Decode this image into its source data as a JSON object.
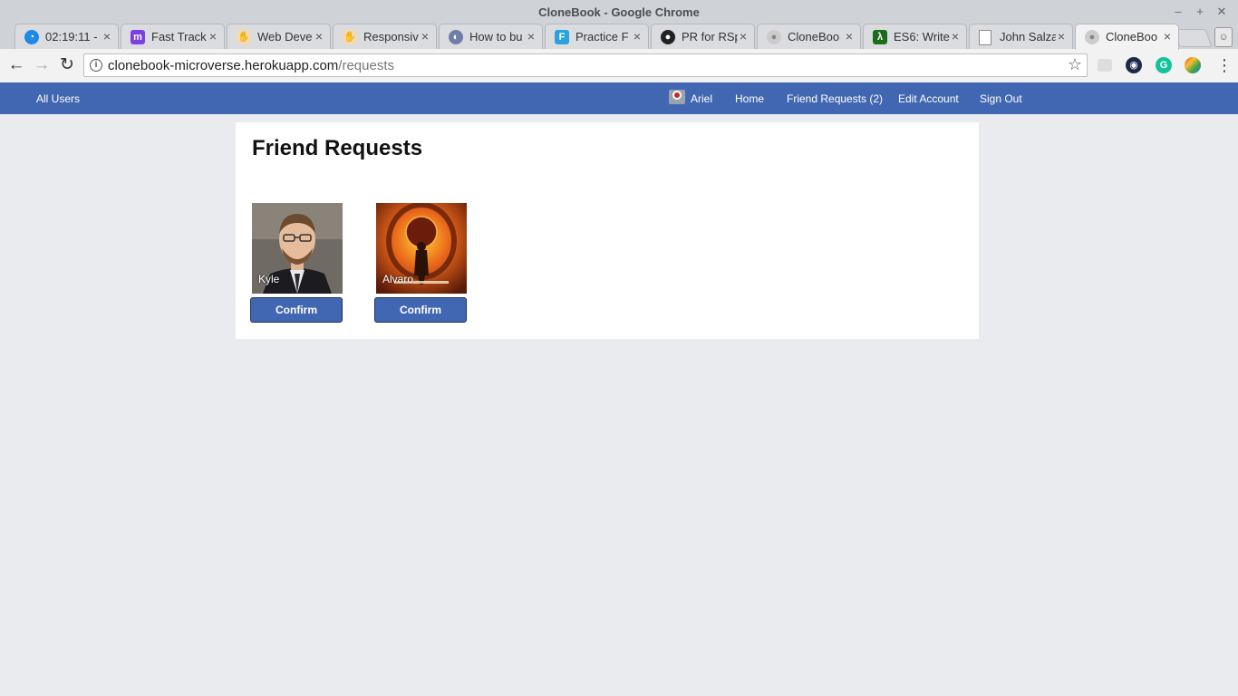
{
  "window": {
    "title": "CloneBook - Google Chrome",
    "minimize": "–",
    "maximize": "+",
    "close": "✕"
  },
  "tabs": [
    {
      "label": "02:19:11 -",
      "favicon": "clock-icon",
      "color": "#1e88e5"
    },
    {
      "label": "Fast Track",
      "favicon": "m-icon",
      "color": "#7b3fe4"
    },
    {
      "label": "Web Deve",
      "favicon": "hand-icon",
      "color": "#e0a060"
    },
    {
      "label": "Responsiv",
      "favicon": "hand-icon",
      "color": "#e0a060"
    },
    {
      "label": "How to bu",
      "favicon": "globe-icon",
      "color": "#6d7fa8"
    },
    {
      "label": "Practice F",
      "favicon": "ft-icon",
      "color": "#29a3e0"
    },
    {
      "label": "PR for RSp",
      "favicon": "github-icon",
      "color": "#222222"
    },
    {
      "label": "CloneBoo",
      "favicon": "person-icon",
      "color": "#bbbbbb"
    },
    {
      "label": "ES6: Write",
      "favicon": "code-icon",
      "color": "#1b6b1b"
    },
    {
      "label": "John Salza",
      "favicon": "document-icon",
      "color": "#888888"
    },
    {
      "label": "CloneBoo",
      "favicon": "person-icon",
      "color": "#bbbbbb"
    }
  ],
  "tab_close": "×",
  "address_bar": {
    "host": "clonebook-microverse.herokuapp.com",
    "path": "/requests"
  },
  "app_nav": {
    "all_users": "All Users",
    "user_name": "Ariel",
    "home": "Home",
    "friend_requests": "Friend Requests (2)",
    "edit_account": "Edit Account",
    "sign_out": "Sign Out",
    "brand_color": "#4267b2"
  },
  "page": {
    "title": "Friend Requests",
    "requests": [
      {
        "name": "Kyle",
        "button": "Confirm"
      },
      {
        "name": "Alvaro",
        "button": "Confirm"
      }
    ]
  }
}
